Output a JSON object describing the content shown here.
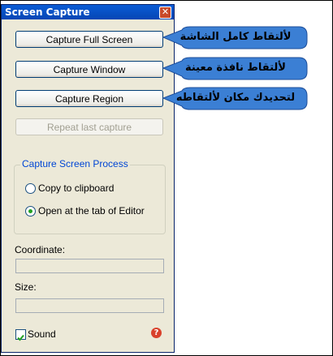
{
  "window": {
    "title": "Screen Capture"
  },
  "buttons": {
    "full": "Capture Full Screen",
    "window": "Capture Window",
    "region": "Capture Region",
    "repeat": "Repeat last capture"
  },
  "process": {
    "label": "Capture Screen Process",
    "option_clipboard": "Copy to clipboard",
    "option_editor": "Open at the tab of Editor",
    "selected": "editor"
  },
  "coordinate": {
    "label": "Coordinate:",
    "value": ""
  },
  "size": {
    "label": "Size:",
    "value": ""
  },
  "sound": {
    "label": "Sound",
    "checked": true
  },
  "annotations": {
    "full": "لألتقاط كامل الشاشة",
    "window": "لألتقاط نافذة معينة",
    "region": "لتحديدك مكان لألتقاطه"
  },
  "colors": {
    "callout_fill": "#3b7fd4",
    "title_bar": "#0a5cd6",
    "radio_dot": "#21a121",
    "group_label": "#0046d5"
  }
}
